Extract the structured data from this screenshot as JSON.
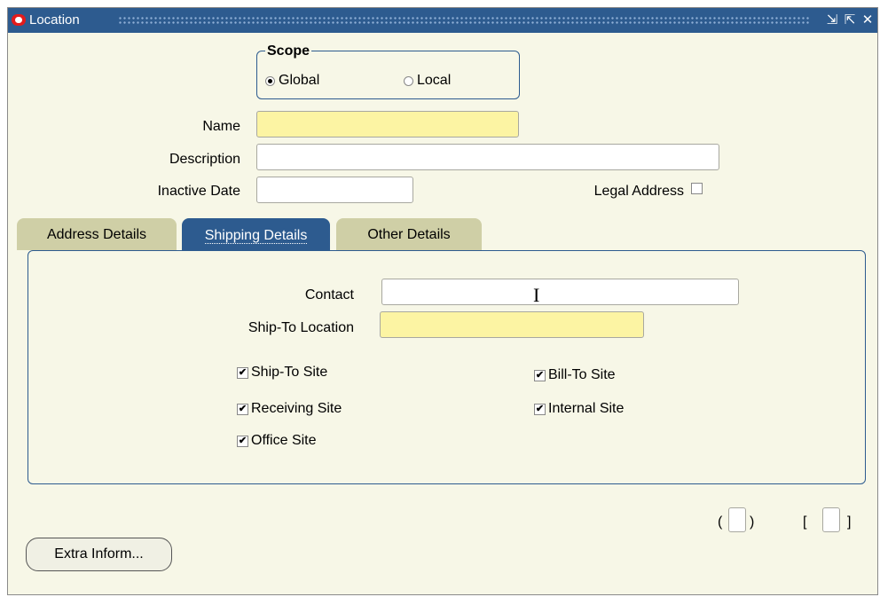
{
  "window": {
    "title": "Location"
  },
  "scope": {
    "title": "Scope",
    "global_label": "Global",
    "local_label": "Local",
    "selected": "Global"
  },
  "form": {
    "name_label": "Name",
    "name_value": "",
    "description_label": "Description",
    "description_value": "",
    "inactive_date_label": "Inactive Date",
    "inactive_date_value": "",
    "legal_address_label": "Legal Address",
    "legal_address_checked": false
  },
  "tabs": [
    {
      "label": "Address Details",
      "active": false
    },
    {
      "label": "Shipping Details",
      "active": true
    },
    {
      "label": "Other Details",
      "active": false
    }
  ],
  "shipping": {
    "contact_label": "Contact",
    "contact_value": "",
    "ship_to_location_label": "Ship-To Location",
    "ship_to_location_value": "",
    "checkboxes": {
      "ship_to_site": {
        "label": "Ship-To Site",
        "checked": true
      },
      "bill_to_site": {
        "label": "Bill-To Site",
        "checked": true
      },
      "receiving_site": {
        "label": "Receiving Site",
        "checked": true
      },
      "internal_site": {
        "label": "Internal Site",
        "checked": true
      },
      "office_site": {
        "label": "Office Site",
        "checked": true
      }
    }
  },
  "footer": {
    "paren_open": "(",
    "paren_close": ")",
    "bracket_open": "[",
    "bracket_close": "]",
    "extra_button_label": "Extra Inform..."
  },
  "icons": {
    "check": "✔",
    "minimize": "⇲",
    "maximize": "⇱",
    "close": "✕"
  }
}
